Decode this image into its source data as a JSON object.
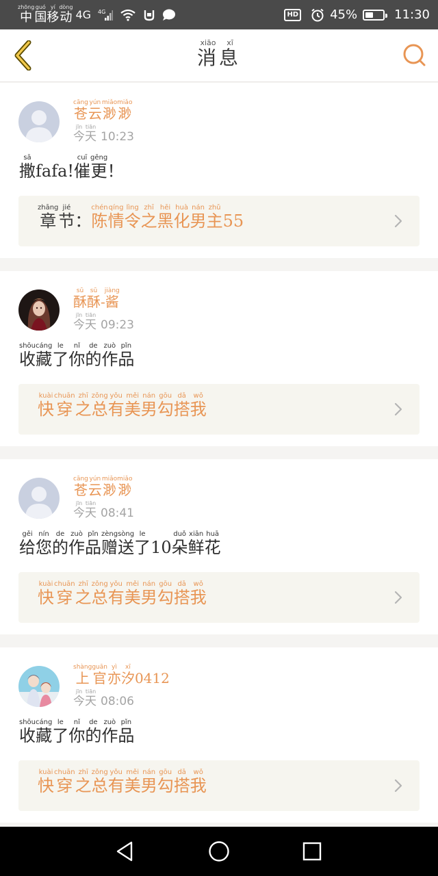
{
  "status_bar": {
    "carrier": [
      {
        "char": "中",
        "py": "zhōng"
      },
      {
        "char": "国",
        "py": "guó"
      },
      {
        "char": "移",
        "py": "yí"
      },
      {
        "char": "动",
        "py": "dòng"
      }
    ],
    "network": "4G",
    "network_small": "4G",
    "hd_badge": "HD",
    "battery_percent": "45%",
    "battery_level": 0.45,
    "time": "11:30",
    "icons": [
      "signal-icon",
      "wifi-icon",
      "notification-icon",
      "chat-icon",
      "alarm-icon",
      "battery-icon"
    ]
  },
  "header": {
    "title": [
      {
        "char": "消",
        "py": "xiāo"
      },
      {
        "char": "息",
        "py": "xī"
      }
    ],
    "back_icon": "chevron-left-icon",
    "search_icon": "search-icon",
    "accent_color": "#e89554"
  },
  "time_prefix": [
    {
      "char": "今",
      "py": "jīn"
    },
    {
      "char": "天",
      "py": "tiān"
    }
  ],
  "messages": [
    {
      "username": [
        {
          "char": "苍",
          "py": "cāng"
        },
        {
          "char": "云",
          "py": "yún"
        },
        {
          "char": "渺",
          "py": "miǎo"
        },
        {
          "char": "渺",
          "py": "miǎo"
        }
      ],
      "username_suffix": "",
      "time": "10:23",
      "avatar": "default-avatar-icon",
      "text_parts": [
        {
          "char": "撒",
          "py": "sā"
        },
        {
          "char": "fafa!",
          "py": ""
        },
        {
          "char": "催",
          "py": "cuī"
        },
        {
          "char": "更",
          "py": "gēng"
        },
        {
          "char": "！",
          "py": ""
        }
      ],
      "work_prefix": [
        {
          "char": "章",
          "py": "zhāng"
        },
        {
          "char": "节",
          "py": "jié"
        },
        {
          "char": "：",
          "py": ""
        }
      ],
      "work": [
        {
          "char": "陈",
          "py": "chén"
        },
        {
          "char": "情",
          "py": "qíng"
        },
        {
          "char": "令",
          "py": "lìng"
        },
        {
          "char": "之",
          "py": "zhī"
        },
        {
          "char": "黑",
          "py": "hēi"
        },
        {
          "char": "化",
          "py": "huà"
        },
        {
          "char": "男",
          "py": "nán"
        },
        {
          "char": "主",
          "py": "zhǔ"
        },
        {
          "char": "55",
          "py": ""
        }
      ]
    },
    {
      "username": [
        {
          "char": "酥",
          "py": "sū"
        },
        {
          "char": "酥",
          "py": "sū"
        },
        {
          "char": "-",
          "py": ""
        },
        {
          "char": "酱",
          "py": "jiàng"
        }
      ],
      "username_suffix": "",
      "time": "09:23",
      "avatar": "anime-girl-avatar",
      "text_parts": [
        {
          "char": "收",
          "py": "shōu"
        },
        {
          "char": "藏",
          "py": "cáng"
        },
        {
          "char": "了",
          "py": "le"
        },
        {
          "char": "你",
          "py": "nǐ"
        },
        {
          "char": "的",
          "py": "de"
        },
        {
          "char": "作",
          "py": "zuò"
        },
        {
          "char": "品",
          "py": "pǐn"
        }
      ],
      "work_prefix": [],
      "work": [
        {
          "char": "快",
          "py": "kuài"
        },
        {
          "char": "穿",
          "py": "chuān"
        },
        {
          "char": "之",
          "py": "zhī"
        },
        {
          "char": "总",
          "py": "zǒng"
        },
        {
          "char": "有",
          "py": "yǒu"
        },
        {
          "char": "美",
          "py": "měi"
        },
        {
          "char": "男",
          "py": "nán"
        },
        {
          "char": "勾",
          "py": "gōu"
        },
        {
          "char": "搭",
          "py": "dā"
        },
        {
          "char": "我",
          "py": "wǒ"
        }
      ]
    },
    {
      "username": [
        {
          "char": "苍",
          "py": "cāng"
        },
        {
          "char": "云",
          "py": "yún"
        },
        {
          "char": "渺",
          "py": "miǎo"
        },
        {
          "char": "渺",
          "py": "miǎo"
        }
      ],
      "username_suffix": "",
      "time": "08:41",
      "avatar": "default-avatar-icon",
      "text_parts": [
        {
          "char": "给",
          "py": "gěi"
        },
        {
          "char": "您",
          "py": "nín"
        },
        {
          "char": "的",
          "py": "de"
        },
        {
          "char": "作",
          "py": "zuò"
        },
        {
          "char": "品",
          "py": "pǐn"
        },
        {
          "char": "赠",
          "py": "zèng"
        },
        {
          "char": "送",
          "py": "sòng"
        },
        {
          "char": "了",
          "py": "le"
        },
        {
          "char": "10",
          "py": ""
        },
        {
          "char": "朵",
          "py": "duǒ"
        },
        {
          "char": "鲜",
          "py": "xiān"
        },
        {
          "char": "花",
          "py": "huā"
        }
      ],
      "work_prefix": [],
      "work": [
        {
          "char": "快",
          "py": "kuài"
        },
        {
          "char": "穿",
          "py": "chuān"
        },
        {
          "char": "之",
          "py": "zhī"
        },
        {
          "char": "总",
          "py": "zǒng"
        },
        {
          "char": "有",
          "py": "yǒu"
        },
        {
          "char": "美",
          "py": "měi"
        },
        {
          "char": "男",
          "py": "nán"
        },
        {
          "char": "勾",
          "py": "gōu"
        },
        {
          "char": "搭",
          "py": "dā"
        },
        {
          "char": "我",
          "py": "wǒ"
        }
      ]
    },
    {
      "username": [
        {
          "char": "上",
          "py": "shàng"
        },
        {
          "char": "官",
          "py": "guān"
        },
        {
          "char": "亦",
          "py": "yì"
        },
        {
          "char": "汐",
          "py": "xī"
        },
        {
          "char": "0412",
          "py": ""
        }
      ],
      "username_suffix": "",
      "time": "08:06",
      "avatar": "anime-couple-avatar",
      "text_parts": [
        {
          "char": "收",
          "py": "shōu"
        },
        {
          "char": "藏",
          "py": "cáng"
        },
        {
          "char": "了",
          "py": "le"
        },
        {
          "char": "你",
          "py": "nǐ"
        },
        {
          "char": "的",
          "py": "de"
        },
        {
          "char": "作",
          "py": "zuò"
        },
        {
          "char": "品",
          "py": "pǐn"
        }
      ],
      "work_prefix": [],
      "work": [
        {
          "char": "快",
          "py": "kuài"
        },
        {
          "char": "穿",
          "py": "chuān"
        },
        {
          "char": "之",
          "py": "zhī"
        },
        {
          "char": "总",
          "py": "zǒng"
        },
        {
          "char": "有",
          "py": "yǒu"
        },
        {
          "char": "美",
          "py": "měi"
        },
        {
          "char": "男",
          "py": "nán"
        },
        {
          "char": "勾",
          "py": "gōu"
        },
        {
          "char": "搭",
          "py": "dā"
        },
        {
          "char": "我",
          "py": "wǒ"
        }
      ]
    }
  ],
  "nav_bar": {
    "icons": [
      "back-triangle-icon",
      "home-circle-icon",
      "recents-square-icon"
    ]
  }
}
